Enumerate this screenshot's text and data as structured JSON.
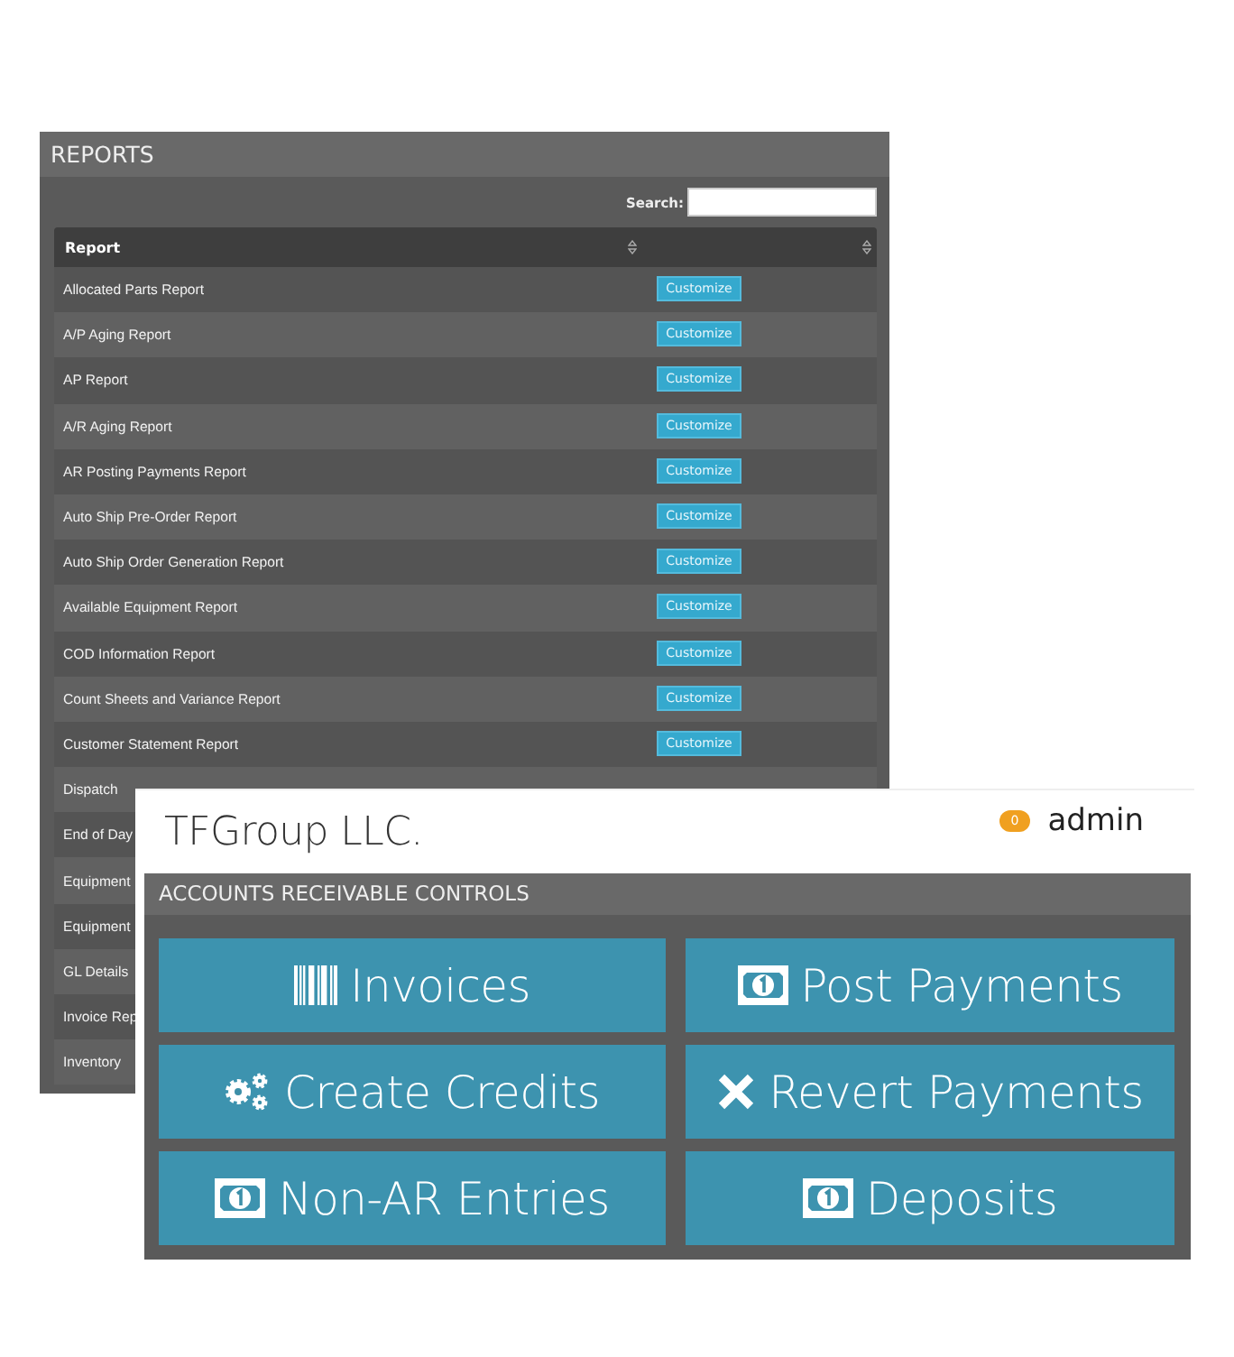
{
  "reports": {
    "title": "REPORTS",
    "search": {
      "label": "Search:"
    },
    "columns": [
      "Report"
    ],
    "rows": [
      {
        "name": "Allocated Parts Report",
        "button": "Customize"
      },
      {
        "name": "A/P Aging Report",
        "button": "Customize"
      },
      {
        "name": "AP Report",
        "button": "Customize"
      },
      {
        "name": "A/R Aging Report",
        "button": "Customize"
      },
      {
        "name": "AR Posting Payments Report",
        "button": "Customize"
      },
      {
        "name": "Auto Ship Pre-Order Report",
        "button": "Customize"
      },
      {
        "name": "Auto Ship Order Generation Report",
        "button": "Customize"
      },
      {
        "name": "Available Equipment Report",
        "button": "Customize"
      },
      {
        "name": "COD Information Report",
        "button": "Customize"
      },
      {
        "name": "Count Sheets and Variance Report",
        "button": "Customize"
      },
      {
        "name": "Customer Statement Report",
        "button": "Customize"
      },
      {
        "name": "Dispatch"
      },
      {
        "name": "End of Day"
      },
      {
        "name": "Equipment"
      },
      {
        "name": "Equipment"
      },
      {
        "name": "GL Details"
      },
      {
        "name": "Invoice Rep"
      },
      {
        "name": "Inventory"
      }
    ]
  },
  "overlay": {
    "company": "TFGroup LLC.",
    "badge": "0",
    "user": "admin",
    "panel_title": "ACCOUNTS RECEIVABLE CONTROLS",
    "buttons": [
      "Invoices",
      "Post Payments",
      "Create Credits",
      "Revert Payments",
      "Non-AR Entries",
      "Deposits"
    ]
  }
}
